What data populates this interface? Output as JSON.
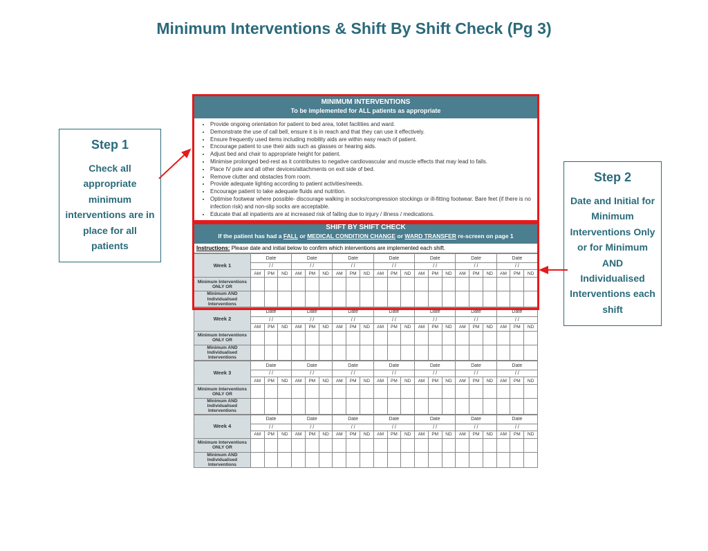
{
  "title": "Minimum Interventions & Shift By Shift Check (Pg 3)",
  "step1": {
    "title": "Step 1",
    "body": "Check all appropriate minimum interventions are in place for all patients"
  },
  "step2": {
    "title": "Step 2",
    "body": "Date and Initial for Minimum Interventions Only or for Minimum AND Individualised Interventions each shift"
  },
  "minInterv": {
    "heading": "MINIMUM INTERVENTIONS",
    "subheading": "To be implemented for ALL patients as appropriate",
    "bullets": [
      "Provide ongoing orientation for patient to bed area, toilet facilities and ward.",
      "Demonstrate the use of call bell, ensure it is in reach and that they can use it effectively.",
      "Ensure frequently used items including mobility aids are within easy reach of patient.",
      "Encourage patient to use their aids such as glasses or hearing aids.",
      "Adjust bed and chair to appropriate height for patient.",
      "Minimise prolonged bed-rest as it contributes to negative cardiovascular and muscle effects that may lead to falls.",
      "Place IV pole and all other devices/attachments on exit side of bed.",
      "Remove clutter and obstacles from room.",
      "Provide adequate lighting according to patient activities/needs.",
      "Encourage patient to take adequate fluids and nutrition.",
      "Optimise footwear where possible- discourage walking in socks/compression stockings or ill-fitting footwear. Bare feet (if there is no infection risk) and non-slip socks are acceptable.",
      "Educate that all inpatients are at increased risk of falling due to injury / illness / medications."
    ]
  },
  "shiftCheck": {
    "heading": "SHIFT BY SHIFT CHECK",
    "subheading_prefix": "If the patient has had a",
    "subheading_terms": [
      "FALL",
      "MEDICAL CONDITION CHANGE",
      "WARD TRANSFER"
    ],
    "subheading_or": "or",
    "subheading_suffix": "re-screen on page 1",
    "instructions_label": "Instructions:",
    "instructions_text": "Please date and initial below to confirm which interventions are implemented each shift.",
    "weeks": [
      "Week 1",
      "Week 2",
      "Week 3",
      "Week 4"
    ],
    "date_label": "Date",
    "slash": "/    /",
    "apn": [
      "AM",
      "PM",
      "ND"
    ],
    "row_a": "Minimum Interventions ONLY OR",
    "row_b": "Minimum AND Individualised Interventions"
  }
}
